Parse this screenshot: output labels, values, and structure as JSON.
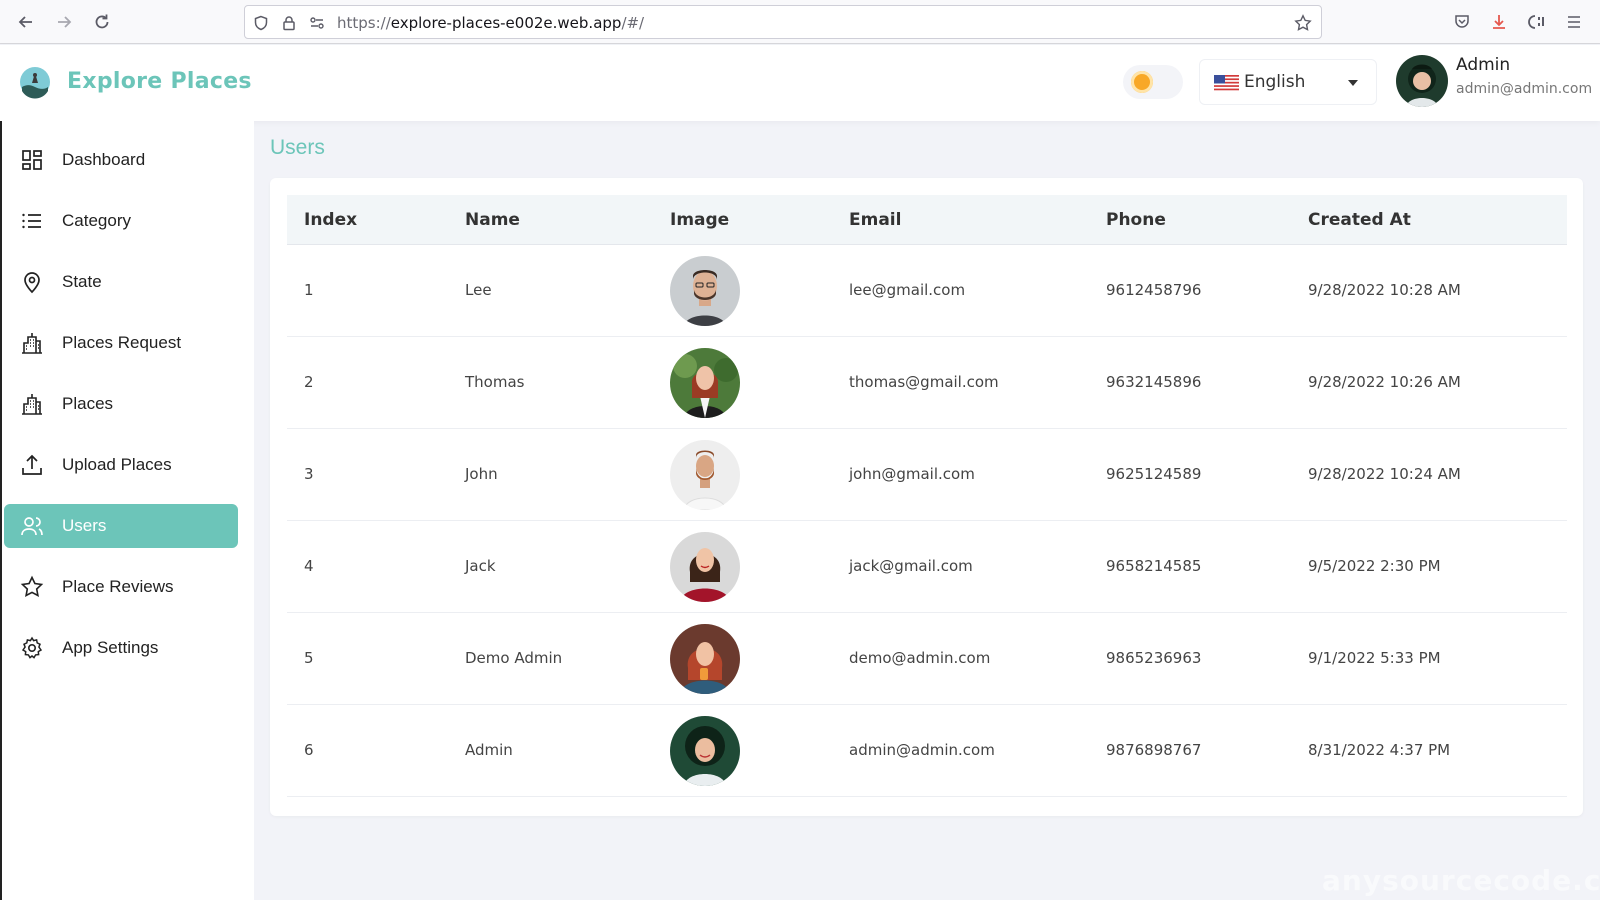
{
  "browser": {
    "url_prefix": "https://",
    "url_host": "explore-places-e002e.web.app",
    "url_path": "/#/"
  },
  "header": {
    "brand": "Explore Places",
    "language": "English",
    "user_name": "Admin",
    "user_email": "admin@admin.com"
  },
  "colors": {
    "accent": "#6cc5b9",
    "toggle_knob": "#f8a827"
  },
  "sidebar": {
    "items": [
      {
        "label": "Dashboard",
        "icon": "dashboard-icon"
      },
      {
        "label": "Category",
        "icon": "list-icon"
      },
      {
        "label": "State",
        "icon": "map-pin-icon"
      },
      {
        "label": "Places Request",
        "icon": "building-icon"
      },
      {
        "label": "Places",
        "icon": "building-icon"
      },
      {
        "label": "Upload Places",
        "icon": "upload-icon"
      },
      {
        "label": "Users",
        "icon": "users-icon",
        "active": true
      },
      {
        "label": "Place Reviews",
        "icon": "star-icon"
      },
      {
        "label": "App Settings",
        "icon": "gear-icon"
      }
    ]
  },
  "main": {
    "title": "Users",
    "table": {
      "headers": [
        "Index",
        "Name",
        "Image",
        "Email",
        "Phone",
        "Created At"
      ],
      "rows": [
        {
          "index": "1",
          "name": "Lee",
          "email": "lee@gmail.com",
          "phone": "9612458796",
          "created": "9/28/2022 10:28 AM"
        },
        {
          "index": "2",
          "name": "Thomas",
          "email": "thomas@gmail.com",
          "phone": "9632145896",
          "created": "9/28/2022 10:26 AM"
        },
        {
          "index": "3",
          "name": "John",
          "email": "john@gmail.com",
          "phone": "9625124589",
          "created": "9/28/2022 10:24 AM"
        },
        {
          "index": "4",
          "name": "Jack",
          "email": "jack@gmail.com",
          "phone": "9658214585",
          "created": "9/5/2022 2:30 PM"
        },
        {
          "index": "5",
          "name": "Demo Admin",
          "email": "demo@admin.com",
          "phone": "9865236963",
          "created": "9/1/2022 5:33 PM"
        },
        {
          "index": "6",
          "name": "Admin",
          "email": "admin@admin.com",
          "phone": "9876898767",
          "created": "8/31/2022 4:37 PM"
        }
      ]
    }
  },
  "watermark": "anysourcecode.com"
}
